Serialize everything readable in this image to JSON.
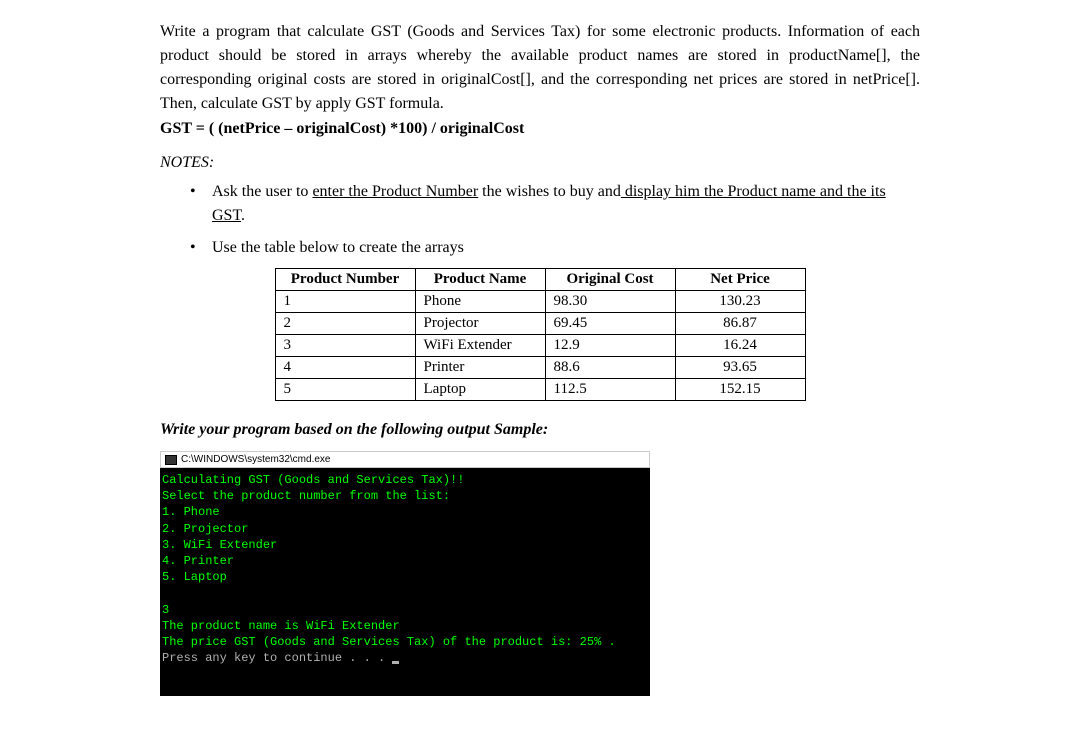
{
  "intro": {
    "paragraph": "Write a program that calculate GST (Goods and Services Tax) for some electronic products. Information of each product should be stored in arrays whereby the available product names are stored in productName[], the corresponding original costs are stored in originalCost[], and the corresponding net prices are stored in netPrice[]. Then, calculate GST by apply GST formula.",
    "formula": "GST = ( (netPrice – originalCost) *100) / originalCost"
  },
  "notes": {
    "header": "NOTES:",
    "item1_prefix": "Ask the user to ",
    "item1_underline1": "enter the Product Number",
    "item1_mid": " the wishes to buy and",
    "item1_underline2": " display him the Product name and the its GST",
    "item1_suffix": ".",
    "item2": "Use the table below to create the arrays"
  },
  "table": {
    "headers": {
      "col1": "Product Number",
      "col2": "Product Name",
      "col3": "Original Cost",
      "col4": "Net Price"
    },
    "rows": [
      {
        "num": "1",
        "name": "Phone",
        "cost": "98.30",
        "price": "130.23"
      },
      {
        "num": "2",
        "name": "Projector",
        "cost": "69.45",
        "price": "86.87"
      },
      {
        "num": "3",
        "name": "WiFi Extender",
        "cost": "12.9",
        "price": "16.24"
      },
      {
        "num": "4",
        "name": "Printer",
        "cost": "88.6",
        "price": "93.65"
      },
      {
        "num": "5",
        "name": "Laptop",
        "cost": "112.5",
        "price": "152.15"
      }
    ]
  },
  "output_prompt": "Write your program based on the following output Sample:",
  "terminal": {
    "title": "C:\\WINDOWS\\system32\\cmd.exe",
    "line1": "Calculating GST (Goods and Services Tax)!!",
    "line2": "Select the product number from the list:",
    "line3": "1. Phone",
    "line4": "2. Projector",
    "line5": "3. WiFi Extender",
    "line6": "4. Printer",
    "line7": "5. Laptop",
    "line8": "",
    "line9": "3",
    "line10": "The product name is WiFi Extender",
    "line11": "The price GST (Goods and Services Tax) of the product is: 25% .",
    "line12": "Press any key to continue . . . "
  }
}
